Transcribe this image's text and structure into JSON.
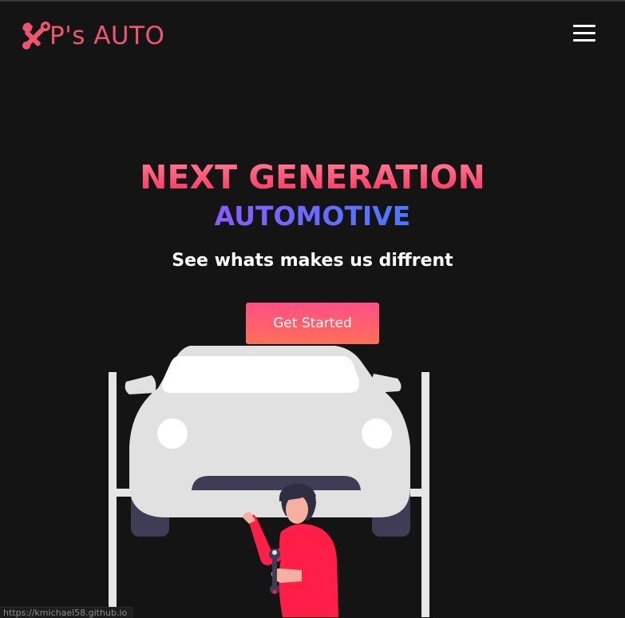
{
  "brand": {
    "logo_text": "P's AUTO",
    "logo_icon": "tools-icon",
    "color": "#f0556f"
  },
  "nav": {
    "menu_icon": "hamburger-menu-icon"
  },
  "hero": {
    "title": "NEXT GENERATION",
    "subtitle": "AUTOMOTIVE",
    "description": "See whats makes us diffrent",
    "cta_label": "Get Started"
  },
  "illustration": {
    "name": "mechanic-car-lift-illustration",
    "car_color": "#e1e1e1",
    "mechanic_shirt_color": "#ff1e47",
    "tire_color": "#3f3d56"
  },
  "status_bar": {
    "url": "https://kmichael58.github.io"
  },
  "colors": {
    "background": "#141414",
    "title_gradient": [
      "#ff2c5c",
      "#ff8197"
    ],
    "subtitle_gradient": [
      "#8a5cff",
      "#4a78ff"
    ],
    "button_gradient": [
      "#ff4f86",
      "#ff6f57"
    ]
  }
}
